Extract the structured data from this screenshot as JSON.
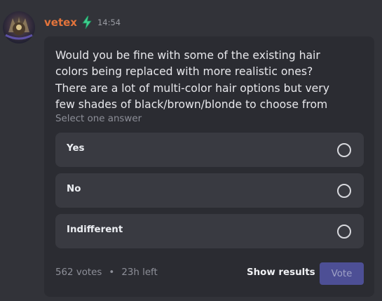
{
  "message": {
    "username": "vetex",
    "timestamp": "14:54",
    "badge_icon": "lightning-bolt-icon"
  },
  "poll": {
    "question_lines": [
      "Would you be fine with some of the existing hair",
      "colors being replaced with more realistic ones?",
      "There are a lot of multi-color hair options but very",
      "few shades of black/brown/blonde to choose from"
    ],
    "prompt": "Select one answer",
    "options": [
      {
        "label": "Yes"
      },
      {
        "label": "No"
      },
      {
        "label": "Indifferent"
      }
    ],
    "votes": "562 votes",
    "separator": "•",
    "time_left": "23h left",
    "show_results_label": "Show results",
    "vote_label": "Vote"
  },
  "colors": {
    "username": "#e3743c",
    "badge": "#3ecf8e",
    "vote_button": "#4d4f95",
    "background": "#323339",
    "poll_card": "#2b2c32"
  }
}
